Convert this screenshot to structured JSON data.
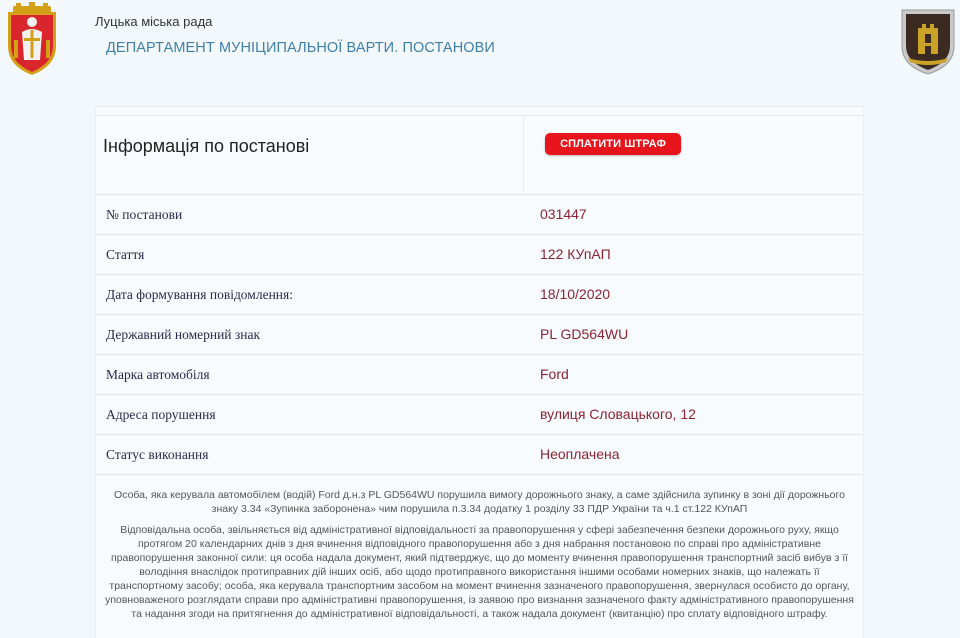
{
  "header": {
    "council": "Луцька міська рада",
    "department": "ДЕПАРТАМЕНТ МУНІЦИПАЛЬНОЇ ВАРТИ. ПОСТАНОВИ",
    "left_emblem_icon": "lutsk-coat-of-arms-icon",
    "right_emblem_icon": "tower-emblem-icon"
  },
  "card": {
    "title": "Інформація по постанові",
    "pay_button_label": "СПЛАТИТИ ШТРАФ",
    "pay_button_color": "#e8141c",
    "value_color": "#8b2332",
    "rows": [
      {
        "label": "№ постанови",
        "value": "031447"
      },
      {
        "label": "Стаття",
        "value": "122 КУпАП"
      },
      {
        "label": "Дата формування повідомлення:",
        "value": "18/10/2020"
      },
      {
        "label": "Державний номерний знак",
        "value": "PL GD564WU"
      },
      {
        "label": "Марка автомобіля",
        "value": "Ford"
      },
      {
        "label": "Адреса порушення",
        "value": "вулиця Словацького, 12"
      },
      {
        "label": "Статус виконання",
        "value": "Неоплачена"
      }
    ],
    "description": "Особа, яка керувала автомобілем (водій) Ford д.н.з PL GD564WU порушила вимогу дорожнього знаку, а саме здійснила зупинку в зоні дії дорожнього знаку 3.34 «Зупинка заборонена» чим порушила п.3.34 додатку 1 розділу 33 ПДР України та ч.1 ст.122 КУпАП",
    "notice": "Відповідальна особа, звільняється від адміністративної відповідальності за правопорушення у сфері забезпечення безпеки дорожнього руху, якщо протягом 20 календарних днів з дня вчинення відповідного правопорушення або з дня набрання постановою по справі про адміністративне правопорушення законної сили: ця особа надала документ, який підтверджує, що до моменту вчинення правопорушення транспортний засіб вибув з її володіння внаслідок протиправних дій інших осіб, або щодо протиправного використання іншими особами номерних знаків, що належать її транспортному засобу; особа, яка керувала транспортним засобом на момент вчинення зазначеного правопорушення, звернулася особисто до органу, уповноваженого розглядати справи про адміністративні правопорушення, із заявою про визнання зазначеного факту адміністративного правопорушення та надання згоди на притягнення до адміністративної відповідальності, а також надала документ (квитанцію) про сплату відповідного штрафу."
  }
}
